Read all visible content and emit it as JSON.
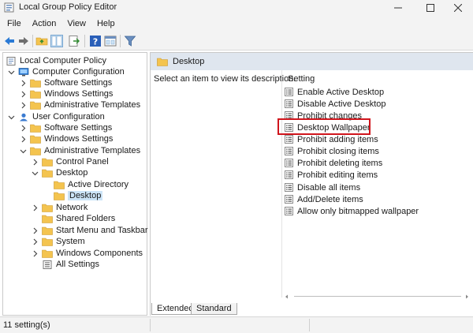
{
  "window": {
    "title": "Local Group Policy Editor"
  },
  "menu": [
    "File",
    "Action",
    "View",
    "Help"
  ],
  "toolbar_icons": [
    "back-arrow-icon",
    "forward-arrow-icon",
    "up-folder-icon",
    "show-hide-tree-icon",
    "export-list-icon",
    "help-icon",
    "properties-icon",
    "filter-icon"
  ],
  "tree": {
    "root": "Local Computer Policy",
    "computer_configuration": {
      "label": "Computer Configuration",
      "children": [
        "Software Settings",
        "Windows Settings",
        "Administrative Templates"
      ]
    },
    "user_configuration": {
      "label": "User Configuration",
      "children": {
        "software_settings": "Software Settings",
        "windows_settings": "Windows Settings",
        "administrative_templates": {
          "label": "Administrative Templates",
          "children": {
            "control_panel": "Control Panel",
            "desktop": {
              "label": "Desktop",
              "children": [
                "Active Directory",
                "Desktop"
              ]
            },
            "others": [
              "Network",
              "Shared Folders",
              "Start Menu and Taskbar",
              "System",
              "Windows Components",
              "All Settings"
            ]
          }
        }
      }
    },
    "selected": "Desktop"
  },
  "content": {
    "header": "Desktop",
    "description": "Select an item to view its description.",
    "column_header": "Setting",
    "settings": [
      "Enable Active Desktop",
      "Disable Active Desktop",
      "Prohibit changes",
      "Desktop Wallpaper",
      "Prohibit adding items",
      "Prohibit closing items",
      "Prohibit deleting items",
      "Prohibit editing items",
      "Disable all items",
      "Add/Delete items",
      "Allow only bitmapped wallpaper"
    ],
    "highlighted_setting": "Desktop Wallpaper",
    "highlight_color": "#d0151c"
  },
  "tabs": [
    "Extended",
    "Standard"
  ],
  "status": {
    "text": "11 setting(s)"
  },
  "colors": {
    "selection": "#cce4f7",
    "header_band": "#dfe6ef",
    "folder": "#f4c44f"
  }
}
